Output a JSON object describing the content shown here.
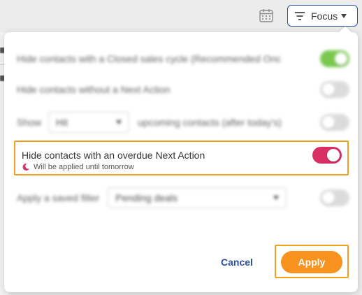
{
  "toolbar": {
    "calendar_icon": "calendar-icon",
    "focus_label": "Focus"
  },
  "panel": {
    "rows": [
      {
        "label": "Hide contacts with a Closed sales cycle (Recommended Onc",
        "enabled": true
      },
      {
        "label": "Hide contacts without a Next Action",
        "enabled": false
      },
      {
        "label_before": "Show",
        "select_value": "Hit",
        "label_after": "upcoming contacts (after today's)",
        "enabled": false
      },
      {
        "label": "Apply a saved filter",
        "select_value": "Pending deals",
        "enabled": false
      }
    ],
    "highlight": {
      "title": "Hide contacts with an overdue Next Action",
      "note": "Will be applied until tomorrow",
      "enabled": true
    },
    "cancel_label": "Cancel",
    "apply_label": "Apply"
  },
  "colors": {
    "accent": "#2c4f9a",
    "toggle_on_pink": "#d83064",
    "toggle_on_green": "#6ec43f",
    "apply": "#f7931e",
    "highlight_border": "#f2a11f"
  }
}
